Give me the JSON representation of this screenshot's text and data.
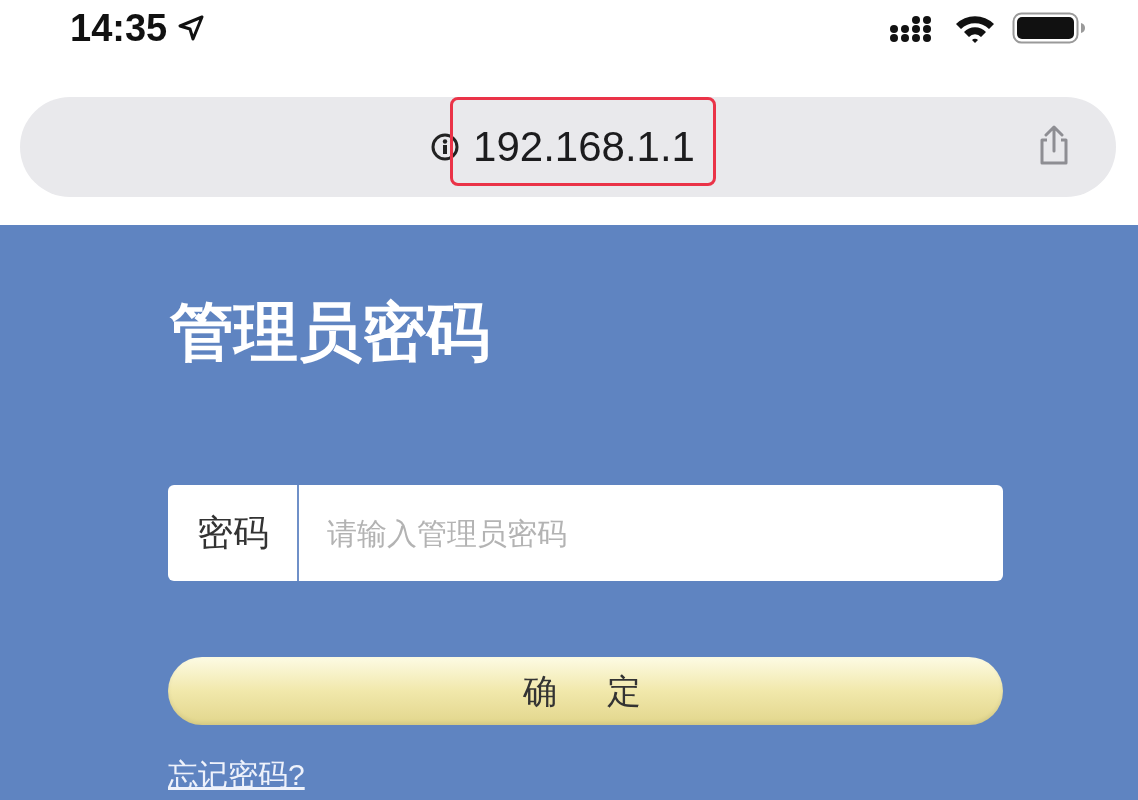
{
  "status_bar": {
    "time": "14:35"
  },
  "address_bar": {
    "url": "192.168.1.1",
    "highlighted": true
  },
  "login_form": {
    "title": "管理员密码",
    "password_field": {
      "label": "密码",
      "placeholder": "请输入管理员密码"
    },
    "submit_button": "确　定",
    "forgot_password_link": "忘记密码?"
  }
}
